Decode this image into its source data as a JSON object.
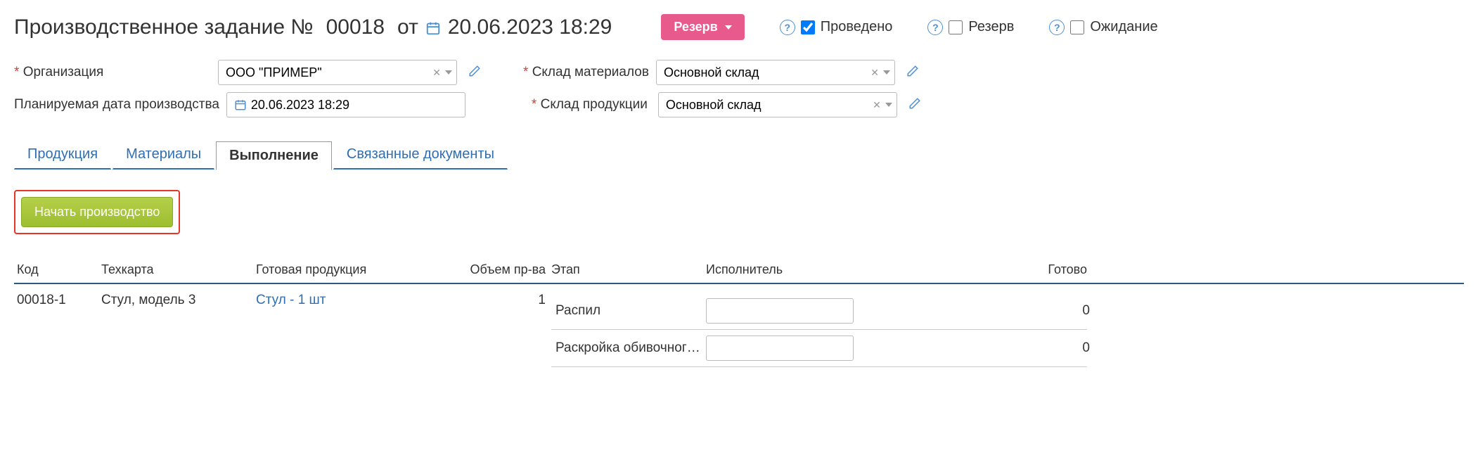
{
  "header": {
    "title_prefix": "Производственное задание №",
    "doc_number": "00018",
    "from_label": "от",
    "date": "20.06.2023 18:29",
    "reserve_btn": "Резерв",
    "checkboxes": {
      "posted": {
        "label": "Проведено",
        "checked": true
      },
      "reserve": {
        "label": "Резерв",
        "checked": false
      },
      "waiting": {
        "label": "Ожидание",
        "checked": false
      }
    }
  },
  "fields": {
    "org": {
      "label": "Организация",
      "value": "ООО \"ПРИМЕР\""
    },
    "plan_date": {
      "label": "Планируемая дата производства",
      "value": "20.06.2023 18:29"
    },
    "mat_wh": {
      "label": "Склад материалов",
      "value": "Основной склад"
    },
    "prod_wh": {
      "label": "Склад продукции",
      "value": "Основной склад"
    }
  },
  "tabs": {
    "t1": "Продукция",
    "t2": "Материалы",
    "t3": "Выполнение",
    "t4": "Связанные документы"
  },
  "start_btn": "Начать производство",
  "grid": {
    "headers": {
      "code": "Код",
      "techcard": "Техкарта",
      "product": "Готовая продукция",
      "volume": "Объем пр-ва",
      "stage": "Этап",
      "executor": "Исполнитель",
      "done": "Готово"
    },
    "rows": [
      {
        "code": "00018-1",
        "techcard": "Стул, модель 3",
        "product": "Стул - 1 шт",
        "volume": "1",
        "stages": [
          {
            "name": "Распил",
            "executor": "",
            "done": "0"
          },
          {
            "name": "Раскройка обивочног…",
            "executor": "",
            "done": "0"
          }
        ]
      }
    ]
  }
}
